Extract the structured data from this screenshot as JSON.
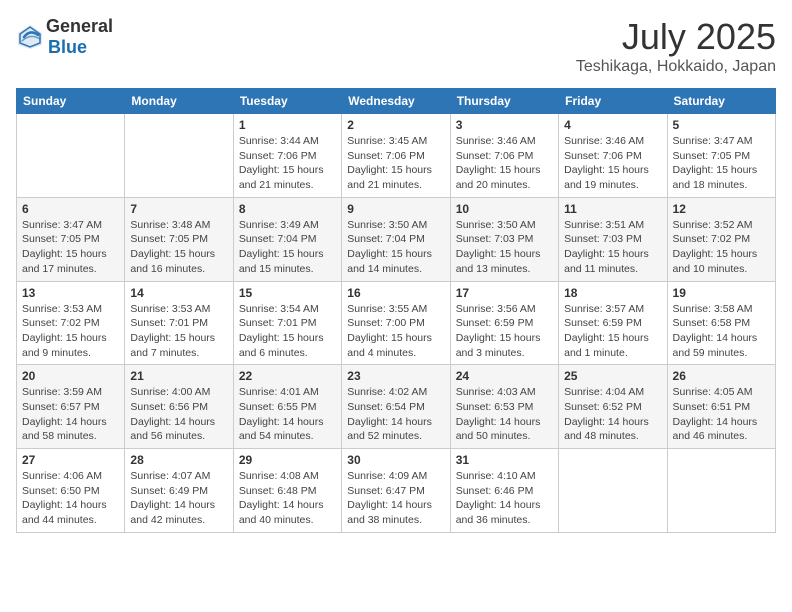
{
  "header": {
    "logo_general": "General",
    "logo_blue": "Blue",
    "month": "July 2025",
    "location": "Teshikaga, Hokkaido, Japan"
  },
  "days_of_week": [
    "Sunday",
    "Monday",
    "Tuesday",
    "Wednesday",
    "Thursday",
    "Friday",
    "Saturday"
  ],
  "weeks": [
    [
      {
        "day": "",
        "sunrise": "",
        "sunset": "",
        "daylight": ""
      },
      {
        "day": "",
        "sunrise": "",
        "sunset": "",
        "daylight": ""
      },
      {
        "day": "1",
        "sunrise": "Sunrise: 3:44 AM",
        "sunset": "Sunset: 7:06 PM",
        "daylight": "Daylight: 15 hours and 21 minutes."
      },
      {
        "day": "2",
        "sunrise": "Sunrise: 3:45 AM",
        "sunset": "Sunset: 7:06 PM",
        "daylight": "Daylight: 15 hours and 21 minutes."
      },
      {
        "day": "3",
        "sunrise": "Sunrise: 3:46 AM",
        "sunset": "Sunset: 7:06 PM",
        "daylight": "Daylight: 15 hours and 20 minutes."
      },
      {
        "day": "4",
        "sunrise": "Sunrise: 3:46 AM",
        "sunset": "Sunset: 7:06 PM",
        "daylight": "Daylight: 15 hours and 19 minutes."
      },
      {
        "day": "5",
        "sunrise": "Sunrise: 3:47 AM",
        "sunset": "Sunset: 7:05 PM",
        "daylight": "Daylight: 15 hours and 18 minutes."
      }
    ],
    [
      {
        "day": "6",
        "sunrise": "Sunrise: 3:47 AM",
        "sunset": "Sunset: 7:05 PM",
        "daylight": "Daylight: 15 hours and 17 minutes."
      },
      {
        "day": "7",
        "sunrise": "Sunrise: 3:48 AM",
        "sunset": "Sunset: 7:05 PM",
        "daylight": "Daylight: 15 hours and 16 minutes."
      },
      {
        "day": "8",
        "sunrise": "Sunrise: 3:49 AM",
        "sunset": "Sunset: 7:04 PM",
        "daylight": "Daylight: 15 hours and 15 minutes."
      },
      {
        "day": "9",
        "sunrise": "Sunrise: 3:50 AM",
        "sunset": "Sunset: 7:04 PM",
        "daylight": "Daylight: 15 hours and 14 minutes."
      },
      {
        "day": "10",
        "sunrise": "Sunrise: 3:50 AM",
        "sunset": "Sunset: 7:03 PM",
        "daylight": "Daylight: 15 hours and 13 minutes."
      },
      {
        "day": "11",
        "sunrise": "Sunrise: 3:51 AM",
        "sunset": "Sunset: 7:03 PM",
        "daylight": "Daylight: 15 hours and 11 minutes."
      },
      {
        "day": "12",
        "sunrise": "Sunrise: 3:52 AM",
        "sunset": "Sunset: 7:02 PM",
        "daylight": "Daylight: 15 hours and 10 minutes."
      }
    ],
    [
      {
        "day": "13",
        "sunrise": "Sunrise: 3:53 AM",
        "sunset": "Sunset: 7:02 PM",
        "daylight": "Daylight: 15 hours and 9 minutes."
      },
      {
        "day": "14",
        "sunrise": "Sunrise: 3:53 AM",
        "sunset": "Sunset: 7:01 PM",
        "daylight": "Daylight: 15 hours and 7 minutes."
      },
      {
        "day": "15",
        "sunrise": "Sunrise: 3:54 AM",
        "sunset": "Sunset: 7:01 PM",
        "daylight": "Daylight: 15 hours and 6 minutes."
      },
      {
        "day": "16",
        "sunrise": "Sunrise: 3:55 AM",
        "sunset": "Sunset: 7:00 PM",
        "daylight": "Daylight: 15 hours and 4 minutes."
      },
      {
        "day": "17",
        "sunrise": "Sunrise: 3:56 AM",
        "sunset": "Sunset: 6:59 PM",
        "daylight": "Daylight: 15 hours and 3 minutes."
      },
      {
        "day": "18",
        "sunrise": "Sunrise: 3:57 AM",
        "sunset": "Sunset: 6:59 PM",
        "daylight": "Daylight: 15 hours and 1 minute."
      },
      {
        "day": "19",
        "sunrise": "Sunrise: 3:58 AM",
        "sunset": "Sunset: 6:58 PM",
        "daylight": "Daylight: 14 hours and 59 minutes."
      }
    ],
    [
      {
        "day": "20",
        "sunrise": "Sunrise: 3:59 AM",
        "sunset": "Sunset: 6:57 PM",
        "daylight": "Daylight: 14 hours and 58 minutes."
      },
      {
        "day": "21",
        "sunrise": "Sunrise: 4:00 AM",
        "sunset": "Sunset: 6:56 PM",
        "daylight": "Daylight: 14 hours and 56 minutes."
      },
      {
        "day": "22",
        "sunrise": "Sunrise: 4:01 AM",
        "sunset": "Sunset: 6:55 PM",
        "daylight": "Daylight: 14 hours and 54 minutes."
      },
      {
        "day": "23",
        "sunrise": "Sunrise: 4:02 AM",
        "sunset": "Sunset: 6:54 PM",
        "daylight": "Daylight: 14 hours and 52 minutes."
      },
      {
        "day": "24",
        "sunrise": "Sunrise: 4:03 AM",
        "sunset": "Sunset: 6:53 PM",
        "daylight": "Daylight: 14 hours and 50 minutes."
      },
      {
        "day": "25",
        "sunrise": "Sunrise: 4:04 AM",
        "sunset": "Sunset: 6:52 PM",
        "daylight": "Daylight: 14 hours and 48 minutes."
      },
      {
        "day": "26",
        "sunrise": "Sunrise: 4:05 AM",
        "sunset": "Sunset: 6:51 PM",
        "daylight": "Daylight: 14 hours and 46 minutes."
      }
    ],
    [
      {
        "day": "27",
        "sunrise": "Sunrise: 4:06 AM",
        "sunset": "Sunset: 6:50 PM",
        "daylight": "Daylight: 14 hours and 44 minutes."
      },
      {
        "day": "28",
        "sunrise": "Sunrise: 4:07 AM",
        "sunset": "Sunset: 6:49 PM",
        "daylight": "Daylight: 14 hours and 42 minutes."
      },
      {
        "day": "29",
        "sunrise": "Sunrise: 4:08 AM",
        "sunset": "Sunset: 6:48 PM",
        "daylight": "Daylight: 14 hours and 40 minutes."
      },
      {
        "day": "30",
        "sunrise": "Sunrise: 4:09 AM",
        "sunset": "Sunset: 6:47 PM",
        "daylight": "Daylight: 14 hours and 38 minutes."
      },
      {
        "day": "31",
        "sunrise": "Sunrise: 4:10 AM",
        "sunset": "Sunset: 6:46 PM",
        "daylight": "Daylight: 14 hours and 36 minutes."
      },
      {
        "day": "",
        "sunrise": "",
        "sunset": "",
        "daylight": ""
      },
      {
        "day": "",
        "sunrise": "",
        "sunset": "",
        "daylight": ""
      }
    ]
  ]
}
